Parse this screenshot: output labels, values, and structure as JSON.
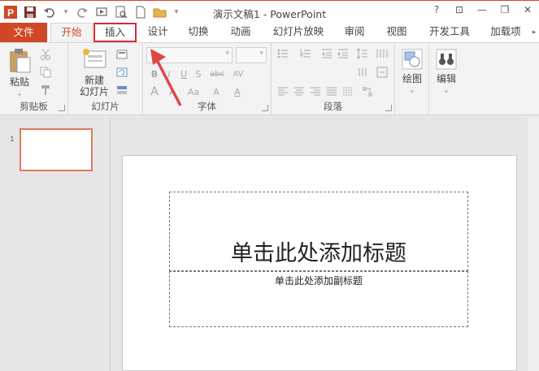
{
  "window": {
    "title": "演示文稿1 - PowerPoint"
  },
  "qat": {
    "icons": [
      "ppt-logo-icon",
      "save-icon",
      "undo-icon",
      "redo-icon",
      "start-from-beginning-icon",
      "print-preview-icon",
      "new-file-icon",
      "open-folder-icon",
      "customize-qat-icon"
    ],
    "logo_letter": "P"
  },
  "window_controls": {
    "help": "?",
    "ribbon_display": "⊡",
    "minimize": "—",
    "restore": "❐",
    "close": "✕"
  },
  "tabs": [
    {
      "label": "文件"
    },
    {
      "label": "开始"
    },
    {
      "label": "插入"
    },
    {
      "label": "设计"
    },
    {
      "label": "切换"
    },
    {
      "label": "动画"
    },
    {
      "label": "幻灯片放映"
    },
    {
      "label": "审阅"
    },
    {
      "label": "视图"
    },
    {
      "label": "开发工具"
    },
    {
      "label": "加载项"
    }
  ],
  "active_tab": "开始",
  "highlighted_tab": "插入",
  "ribbon": {
    "groups": [
      {
        "label": "剪贴板",
        "big_buttons": [
          {
            "label": "粘贴"
          }
        ]
      },
      {
        "label": "幻灯片",
        "big_buttons": [
          {
            "label": "新建"
          },
          {
            "label": "幻灯片"
          }
        ]
      },
      {
        "label": "字体"
      },
      {
        "label": "段落"
      },
      {
        "label": "",
        "big_buttons": [
          {
            "label": "绘图"
          }
        ]
      },
      {
        "label": "",
        "big_buttons": [
          {
            "label": "编辑"
          }
        ]
      }
    ],
    "font_buttons": {
      "bold": "B",
      "italic": "I",
      "underline": "U",
      "strike": "S",
      "shadow": "abc",
      "spacing": "AV",
      "grow": "A",
      "shrink": "A",
      "case": "Aa",
      "clear": "A",
      "color": "A"
    }
  },
  "slides_pane": {
    "slide_number": "1"
  },
  "slide": {
    "title_placeholder": "单击此处添加标题",
    "subtitle_placeholder": "单击此处添加副标题"
  },
  "colors": {
    "accent": "#d24726",
    "highlight": "#d9283a"
  }
}
